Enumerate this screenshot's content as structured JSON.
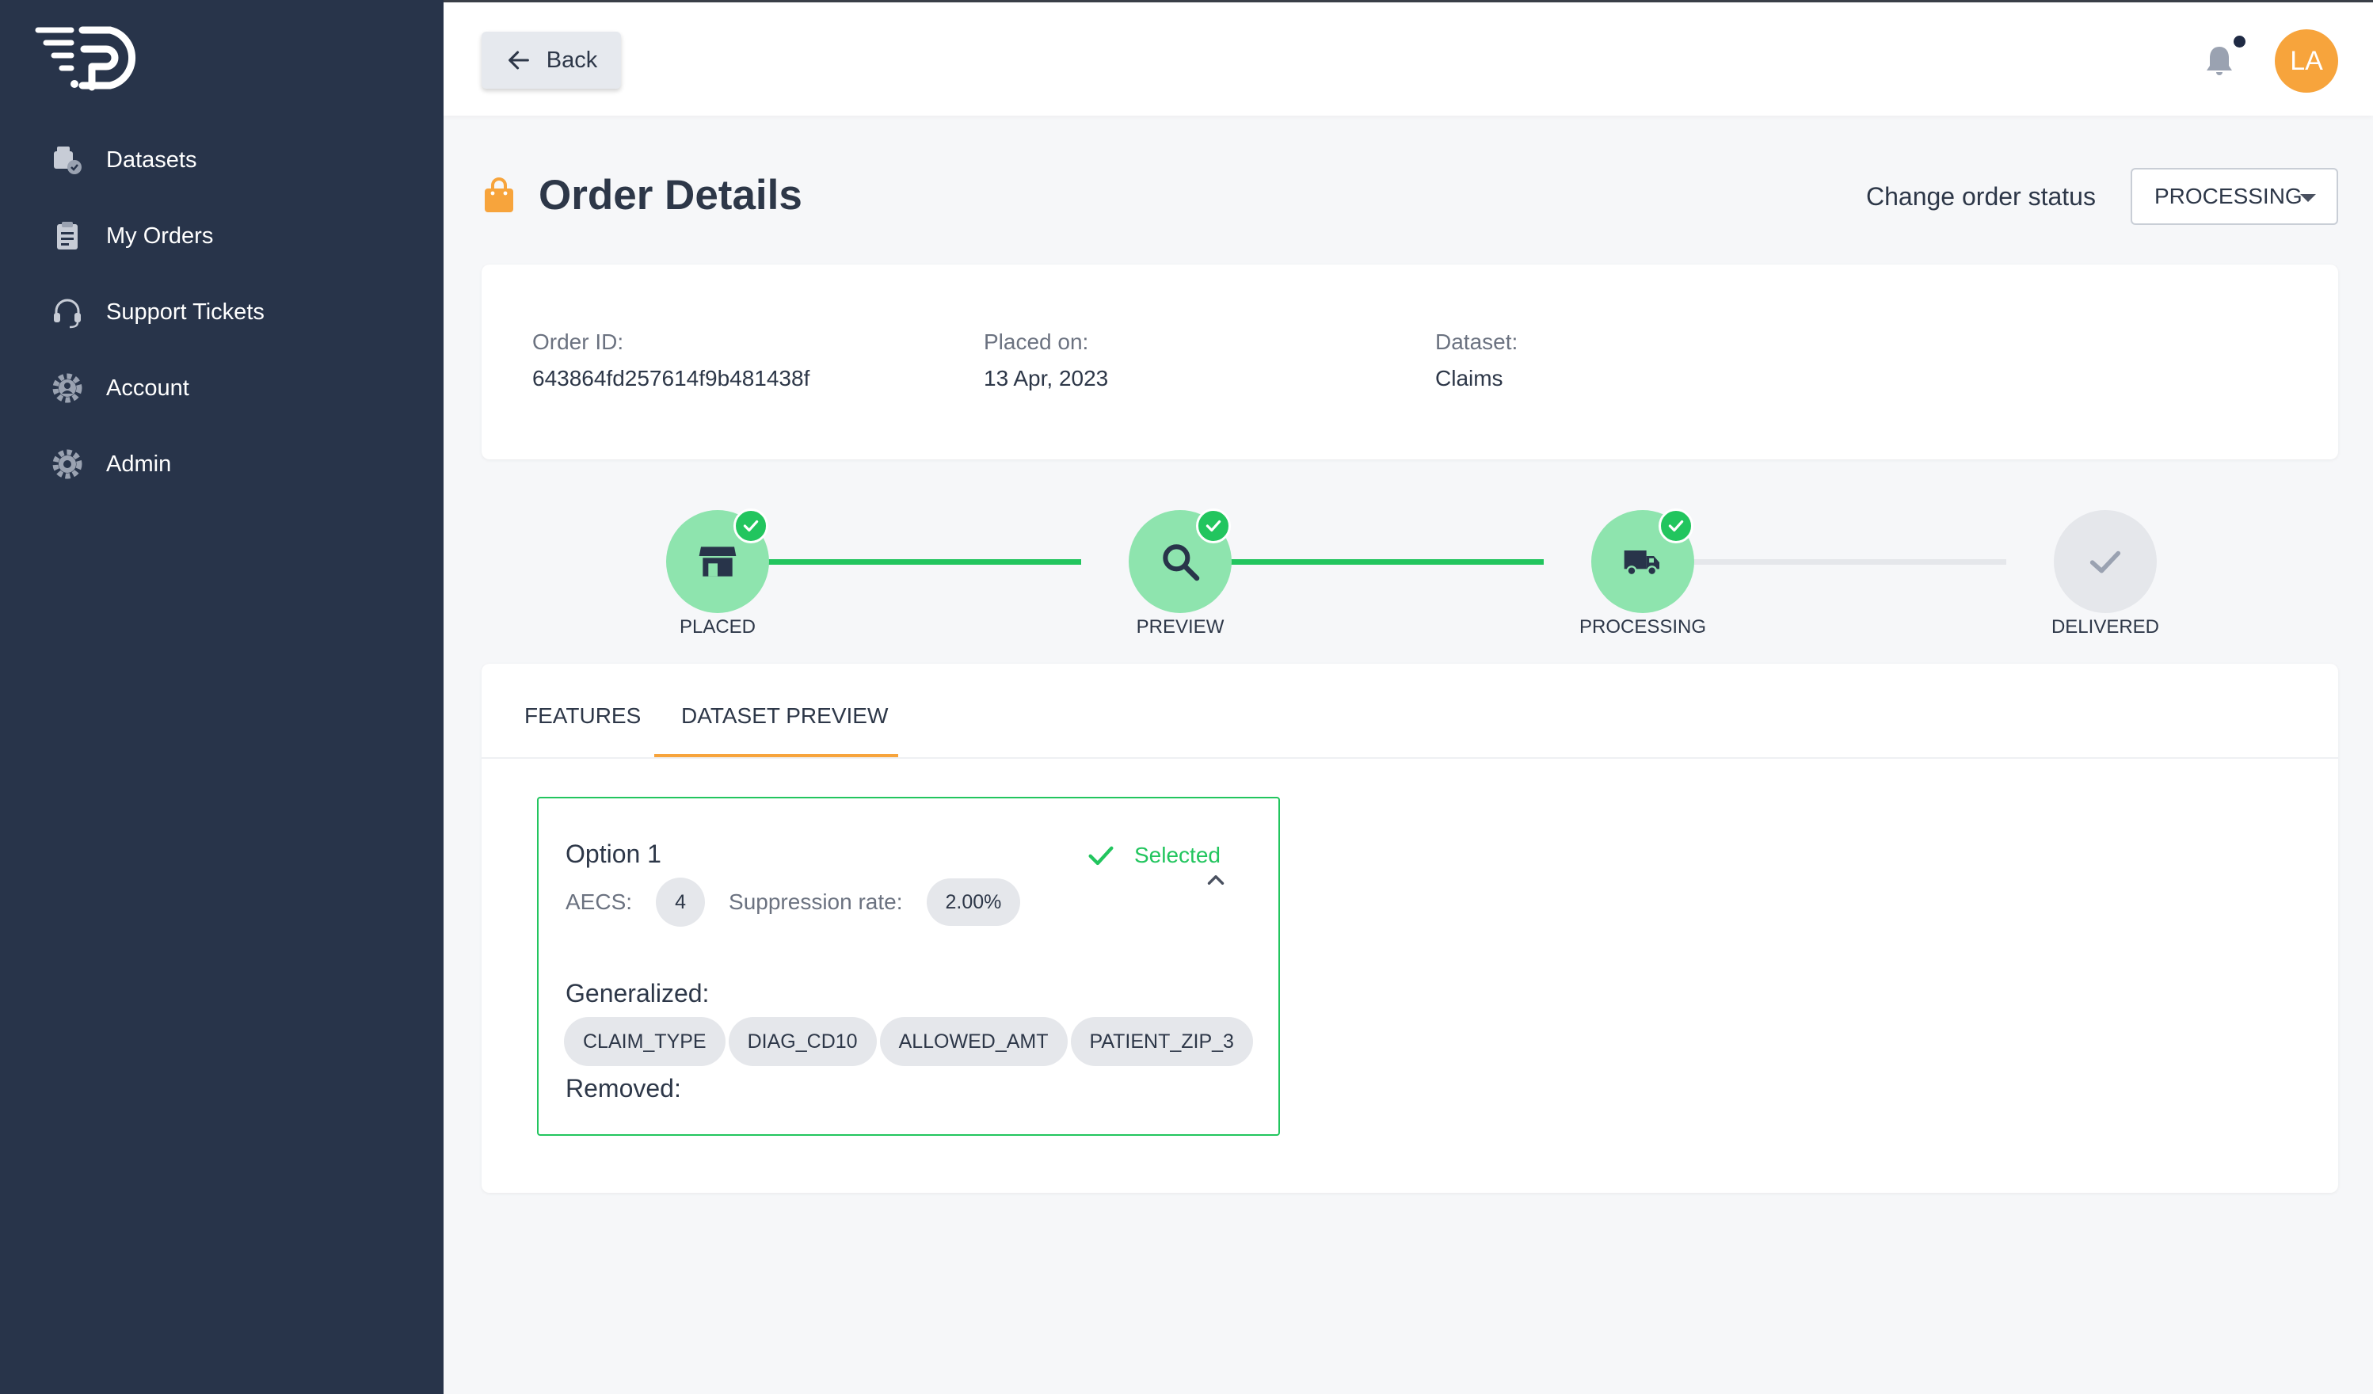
{
  "sidebar": {
    "logo_icon": "brand-logo",
    "items": [
      {
        "label": "Datasets",
        "icon": "datasets-icon"
      },
      {
        "label": "My Orders",
        "icon": "clipboard-icon"
      },
      {
        "label": "Support Tickets",
        "icon": "headset-icon"
      },
      {
        "label": "Account",
        "icon": "account-gear-icon"
      },
      {
        "label": "Admin",
        "icon": "settings-gear-icon"
      }
    ]
  },
  "topbar": {
    "back_label": "Back",
    "notification_icon": "bell-icon",
    "avatar_initials": "LA"
  },
  "page": {
    "title": "Order Details",
    "change_status_label": "Change order status",
    "status_value": "PROCESSING"
  },
  "order": {
    "id_label": "Order ID:",
    "id_value": "643864fd257614f9b481438f",
    "placed_label": "Placed on:",
    "placed_value": "13 Apr, 2023",
    "dataset_label": "Dataset:",
    "dataset_value": "Claims"
  },
  "stepper": {
    "steps": [
      {
        "label": "PLACED",
        "completed": true,
        "icon": "store-icon"
      },
      {
        "label": "PREVIEW",
        "completed": true,
        "icon": "search-icon"
      },
      {
        "label": "PROCESSING",
        "completed": true,
        "icon": "truck-icon"
      },
      {
        "label": "DELIVERED",
        "completed": false,
        "icon": "check-icon"
      }
    ],
    "colors": {
      "done_circle": "#8ee4ae",
      "done_line": "#22c55e",
      "pending_circle": "#e5e7eb",
      "pending_line": "#e5e7eb"
    }
  },
  "tabs": {
    "items": [
      {
        "label": "FEATURES"
      },
      {
        "label": "DATASET PREVIEW"
      }
    ],
    "active_index": 1
  },
  "option": {
    "title": "Option 1",
    "selected_label": "Selected",
    "aecs_label": "AECS:",
    "aecs_value": "4",
    "suppression_label": "Suppression rate:",
    "suppression_value": "2.00%",
    "generalized_label": "Generalized:",
    "generalized": [
      "CLAIM_TYPE",
      "DIAG_CD10",
      "ALLOWED_AMT",
      "PATIENT_ZIP_3"
    ],
    "removed_label": "Removed:"
  },
  "colors": {
    "sidebar_bg": "#28344a",
    "accent_orange": "#f7a43c",
    "success_green": "#22c55e"
  }
}
